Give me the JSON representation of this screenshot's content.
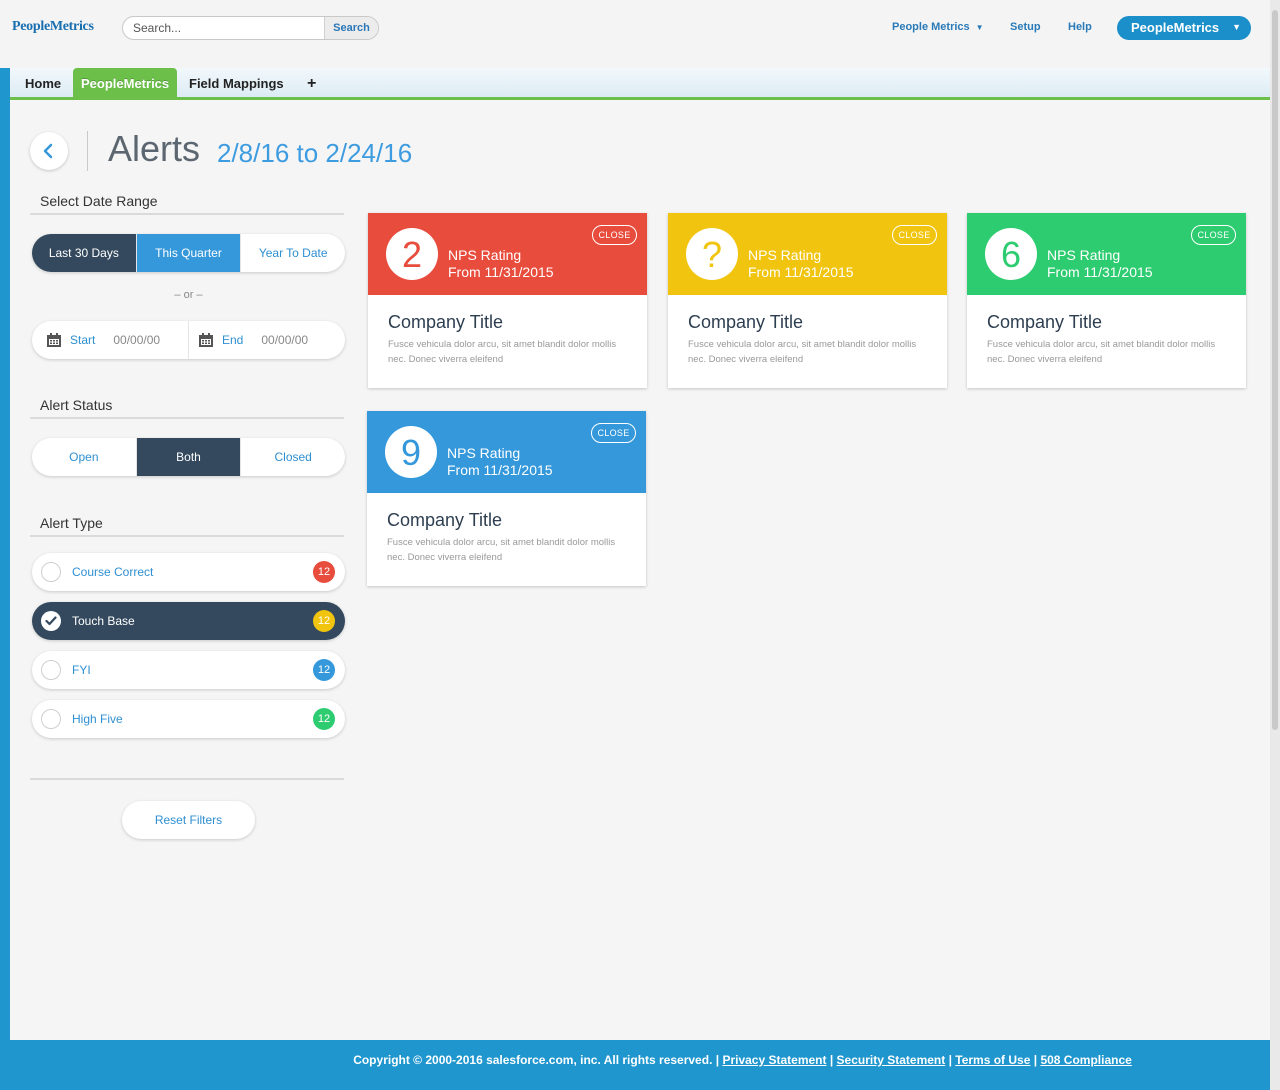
{
  "header": {
    "logo": "PeopleMetrics",
    "search_placeholder": "Search...",
    "search_button": "Search",
    "nav": [
      {
        "label": "People Metrics"
      },
      {
        "label": "Setup"
      },
      {
        "label": "Help"
      }
    ],
    "app_menu": "PeopleMetrics"
  },
  "tabs": [
    {
      "label": "Home"
    },
    {
      "label": "PeopleMetrics",
      "active": true
    },
    {
      "label": "Field Mappings"
    },
    {
      "label": "+"
    }
  ],
  "page": {
    "title": "Alerts",
    "date_range": "2/8/16 to 2/24/16"
  },
  "filters": {
    "date_range_label": "Select Date Range",
    "date_options": [
      "Last 30 Days",
      "This Quarter",
      "Year To Date"
    ],
    "or_text": "– or –",
    "start_label": "Start",
    "start_value": "00/00/00",
    "end_label": "End",
    "end_value": "00/00/00",
    "status_label": "Alert Status",
    "status_options": [
      "Open",
      "Both",
      "Closed"
    ],
    "type_label": "Alert Type",
    "types": [
      {
        "label": "Course Correct",
        "count": "12",
        "color": "#e74c3c",
        "selected": false
      },
      {
        "label": "Touch Base",
        "count": "12",
        "color": "#f1c40f",
        "selected": true
      },
      {
        "label": "FYI",
        "count": "12",
        "color": "#3498db",
        "selected": false
      },
      {
        "label": "High Five",
        "count": "12",
        "color": "#2ecc71",
        "selected": false
      }
    ],
    "reset_label": "Reset Filters"
  },
  "cards": [
    {
      "score": "2",
      "color": "#e74c3c",
      "rating_label": "NPS Rating",
      "from": "From 11/31/2015",
      "close": "CLOSE",
      "title": "Company Title",
      "desc": "Fusce vehicula dolor arcu, sit amet blandit dolor mollis nec. Donec viverra eleifend"
    },
    {
      "score": "?",
      "color": "#f1c40f",
      "rating_label": "NPS Rating",
      "from": "From 11/31/2015",
      "close": "CLOSE",
      "title": "Company Title",
      "desc": "Fusce vehicula dolor arcu, sit amet blandit dolor mollis nec. Donec viverra eleifend"
    },
    {
      "score": "6",
      "color": "#2ecc71",
      "rating_label": "NPS Rating",
      "from": "From 11/31/2015",
      "close": "CLOSE",
      "title": "Company Title",
      "desc": "Fusce vehicula dolor arcu, sit amet blandit dolor mollis nec. Donec viverra eleifend"
    },
    {
      "score": "9",
      "color": "#3498db",
      "rating_label": "NPS Rating",
      "from": "From 11/31/2015",
      "close": "CLOSE",
      "title": "Company Title",
      "desc": "Fusce vehicula dolor arcu, sit amet blandit dolor mollis nec. Donec viverra eleifend"
    }
  ],
  "footer": {
    "copyright": "Copyright © 2000-2016 salesforce.com, inc. All rights reserved. |",
    "links": [
      "Privacy Statement",
      "Security Statement",
      "Terms of Use",
      "508 Compliance"
    ]
  },
  "colors": {
    "accent": "#3498db",
    "dark": "#34495e",
    "green_tab": "#6cc04a",
    "footer_bg": "#1f96cd"
  }
}
